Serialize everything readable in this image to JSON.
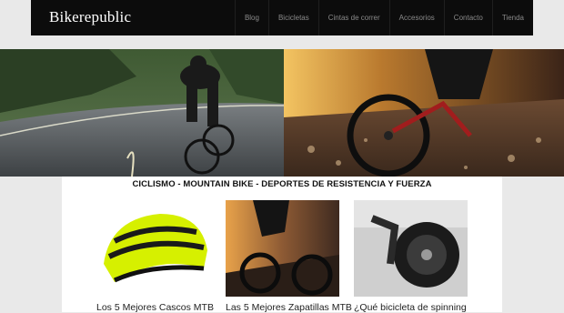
{
  "header": {
    "brand": "Bikerepublic",
    "nav": [
      "Blog",
      "Bicicletas",
      "Cintas de correr",
      "Accesorios",
      "Contacto",
      "Tienda"
    ]
  },
  "main": {
    "tagline": "CICLISMO - MOUNTAIN BIKE - DEPORTES DE RESISTENCIA Y FUERZA",
    "cards": [
      {
        "title": "Los 5 Mejores Cascos MTB"
      },
      {
        "title": "Las 5 Mejores Zapatillas MTB"
      },
      {
        "title": "¿Qué bicicleta de spinning"
      }
    ]
  }
}
